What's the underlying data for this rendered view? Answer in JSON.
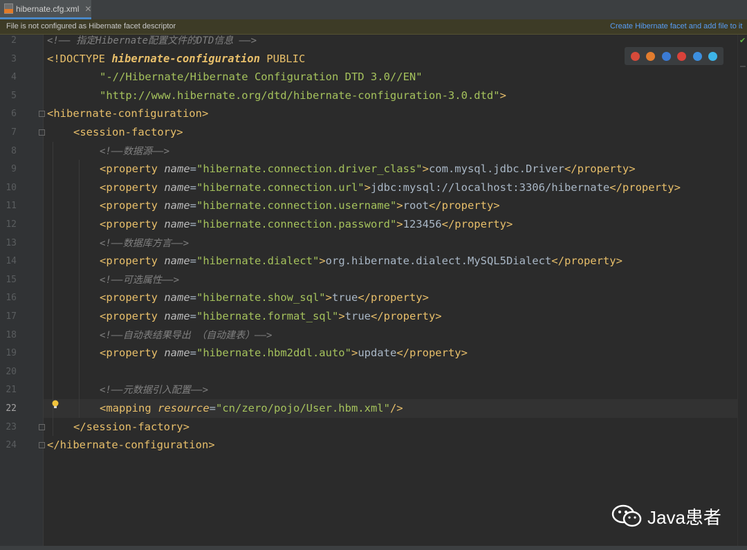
{
  "tab": {
    "filename": "hibernate.cfg.xml",
    "close": "✕"
  },
  "banner": {
    "message": "File is not configured as Hibernate facet descriptor",
    "action": "Create Hibernate facet and add file to it"
  },
  "current_line": 22,
  "lines": [
    {
      "n": "2",
      "segs": [
        [
          "cm",
          "<!—— 指定Hibernate配置文件的DTD信息 ——>"
        ]
      ],
      "indent": 0
    },
    {
      "n": "3",
      "segs": [
        [
          "tag",
          "<!DOCTYPE "
        ],
        [
          "tagi",
          "hibernate-configuration"
        ],
        [
          "tag",
          " PUBLIC"
        ]
      ],
      "indent": 0
    },
    {
      "n": "4",
      "segs": [
        [
          "str",
          "\"-//Hibernate/Hibernate Configuration DTD 3.0//EN\""
        ]
      ],
      "indent": 2
    },
    {
      "n": "5",
      "segs": [
        [
          "str",
          "\"http://www.hibernate.org/dtd/hibernate-configuration-3.0.dtd\""
        ],
        [
          "tag",
          ">"
        ]
      ],
      "indent": 2
    },
    {
      "n": "6",
      "segs": [
        [
          "tag",
          "<hibernate-configuration>"
        ]
      ],
      "indent": 0
    },
    {
      "n": "7",
      "segs": [
        [
          "tag",
          "<session-factory>"
        ]
      ],
      "indent": 1
    },
    {
      "n": "8",
      "segs": [
        [
          "cm",
          "<!——数据源——>"
        ]
      ],
      "indent": 2
    },
    {
      "n": "9",
      "segs": [
        [
          "tag",
          "<property "
        ],
        [
          "attr",
          "name"
        ],
        [
          "txt",
          "="
        ],
        [
          "str",
          "\"hibernate.connection.driver_class\""
        ],
        [
          "tag",
          ">"
        ],
        [
          "txt",
          "com.mysql.jdbc.Driver"
        ],
        [
          "tag",
          "</property>"
        ]
      ],
      "indent": 2
    },
    {
      "n": "10",
      "segs": [
        [
          "tag",
          "<property "
        ],
        [
          "attr",
          "name"
        ],
        [
          "txt",
          "="
        ],
        [
          "str",
          "\"hibernate.connection.url\""
        ],
        [
          "tag",
          ">"
        ],
        [
          "txt",
          "jdbc:mysql://localhost:3306/hibernate"
        ],
        [
          "tag",
          "</property>"
        ]
      ],
      "indent": 2
    },
    {
      "n": "11",
      "segs": [
        [
          "tag",
          "<property "
        ],
        [
          "attr",
          "name"
        ],
        [
          "txt",
          "="
        ],
        [
          "str",
          "\"hibernate.connection.username\""
        ],
        [
          "tag",
          ">"
        ],
        [
          "txt",
          "root"
        ],
        [
          "tag",
          "</property>"
        ]
      ],
      "indent": 2
    },
    {
      "n": "12",
      "segs": [
        [
          "tag",
          "<property "
        ],
        [
          "attr",
          "name"
        ],
        [
          "txt",
          "="
        ],
        [
          "str",
          "\"hibernate.connection.password\""
        ],
        [
          "tag",
          ">"
        ],
        [
          "txt",
          "123456"
        ],
        [
          "tag",
          "</property>"
        ]
      ],
      "indent": 2
    },
    {
      "n": "13",
      "segs": [
        [
          "cm",
          "<!——数据库方言——>"
        ]
      ],
      "indent": 2
    },
    {
      "n": "14",
      "segs": [
        [
          "tag",
          "<property "
        ],
        [
          "attr",
          "name"
        ],
        [
          "txt",
          "="
        ],
        [
          "str",
          "\"hibernate.dialect\""
        ],
        [
          "tag",
          ">"
        ],
        [
          "txt",
          "org.hibernate.dialect.MySQL5Dialect"
        ],
        [
          "tag",
          "</property>"
        ]
      ],
      "indent": 2
    },
    {
      "n": "15",
      "segs": [
        [
          "cm",
          "<!——可选属性——>"
        ]
      ],
      "indent": 2
    },
    {
      "n": "16",
      "segs": [
        [
          "tag",
          "<property "
        ],
        [
          "attr",
          "name"
        ],
        [
          "txt",
          "="
        ],
        [
          "str",
          "\"hibernate.show_sql\""
        ],
        [
          "tag",
          ">"
        ],
        [
          "txt",
          "true"
        ],
        [
          "tag",
          "</property>"
        ]
      ],
      "indent": 2
    },
    {
      "n": "17",
      "segs": [
        [
          "tag",
          "<property "
        ],
        [
          "attr",
          "name"
        ],
        [
          "txt",
          "="
        ],
        [
          "str",
          "\"hibernate.format_sql\""
        ],
        [
          "tag",
          ">"
        ],
        [
          "txt",
          "true"
        ],
        [
          "tag",
          "</property>"
        ]
      ],
      "indent": 2
    },
    {
      "n": "18",
      "segs": [
        [
          "cm",
          "<!——自动表结果导出 （自动建表）——>"
        ]
      ],
      "indent": 2
    },
    {
      "n": "19",
      "segs": [
        [
          "tag",
          "<property "
        ],
        [
          "attr",
          "name"
        ],
        [
          "txt",
          "="
        ],
        [
          "str",
          "\"hibernate.hbm2ddl.auto\""
        ],
        [
          "tag",
          ">"
        ],
        [
          "txt",
          "update"
        ],
        [
          "tag",
          "</property>"
        ]
      ],
      "indent": 2
    },
    {
      "n": "20",
      "segs": [],
      "indent": 0
    },
    {
      "n": "21",
      "segs": [
        [
          "cm",
          "<!——元数据引入配置——>"
        ]
      ],
      "indent": 2
    },
    {
      "n": "22",
      "segs": [
        [
          "tag",
          "<mapping "
        ],
        [
          "attri",
          "resource"
        ],
        [
          "txt",
          "="
        ],
        [
          "str",
          "\"cn/zero/pojo/User.hbm.xml\""
        ],
        [
          "tag",
          "/>"
        ]
      ],
      "indent": 2
    },
    {
      "n": "23",
      "segs": [
        [
          "tag",
          "</session-factory>"
        ]
      ],
      "indent": 1
    },
    {
      "n": "24",
      "segs": [
        [
          "tag",
          "</hibernate-configuration>"
        ]
      ],
      "indent": 0
    }
  ],
  "browsers": [
    "chrome-icon",
    "firefox-icon",
    "safari-icon",
    "opera-icon",
    "ie-icon",
    "edge-icon"
  ],
  "watermark": {
    "text": "Java患者"
  },
  "colors": {
    "tag": "#e8bf6a",
    "attr": "#bababa",
    "string": "#a5c25c",
    "comment": "#808080",
    "text": "#a9b7c6",
    "link": "#589df6"
  }
}
